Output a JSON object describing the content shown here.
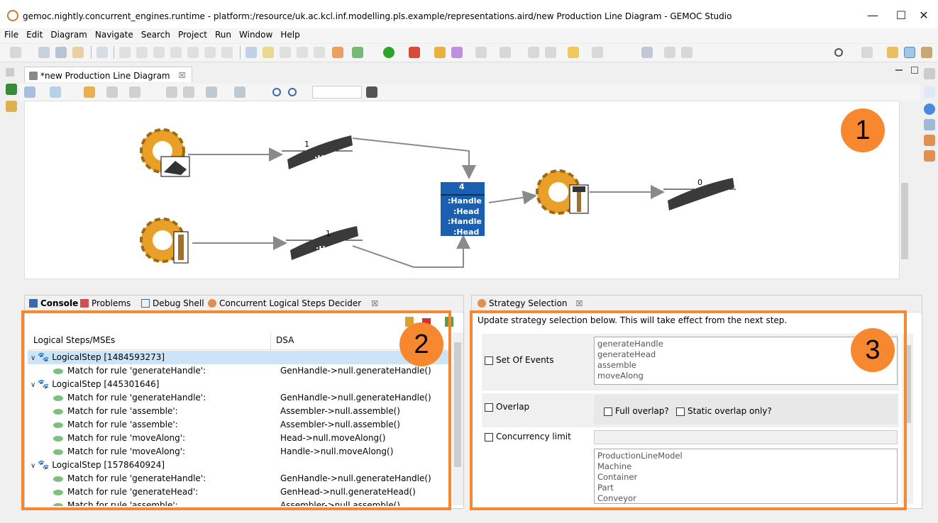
{
  "window": {
    "title": "gemoc.nightly.concurrent_engines.runtime - platform:/resource/uk.ac.kcl.inf.modelling.pls.example/representations.aird/new Production Line Diagram - GEMOC Studio",
    "minimize": "—",
    "maximize": "☐",
    "close": "✕"
  },
  "menu": [
    "File",
    "Edit",
    "Diagram",
    "Navigate",
    "Search",
    "Project",
    "Run",
    "Window",
    "Help"
  ],
  "editor": {
    "tab_label": "*new Production Line Diagram",
    "tab_close": "☒"
  },
  "diagram": {
    "nodes": {
      "head_conveyor_top": {
        "count": "1",
        "label": ":Head"
      },
      "handle_conveyor_bottom": {
        "count": "1",
        "label": ":Handle"
      },
      "container": {
        "count": "4",
        "items": [
          ":Handle",
          ":Head",
          ":Handle",
          ":Head"
        ]
      },
      "output_conveyor": {
        "count": "0"
      }
    }
  },
  "console_panel": {
    "tabs": [
      "Console",
      "Problems",
      "Debug Shell",
      "Concurrent Logical Steps Decider"
    ],
    "columns": [
      "Logical Steps/MSEs",
      "DSA"
    ],
    "rows": [
      {
        "kind": "step",
        "label": "LogicalStep [1484593273]",
        "dsa": ""
      },
      {
        "kind": "mse",
        "label": "Match for rule 'generateHandle':",
        "dsa": "GenHandle->null.generateHandle()"
      },
      {
        "kind": "step",
        "label": "LogicalStep [445301646]",
        "dsa": ""
      },
      {
        "kind": "mse",
        "label": "Match for rule 'generateHandle':",
        "dsa": "GenHandle->null.generateHandle()"
      },
      {
        "kind": "mse",
        "label": "Match for rule 'assemble':",
        "dsa": "Assembler->null.assemble()"
      },
      {
        "kind": "mse",
        "label": "Match for rule 'assemble':",
        "dsa": "Assembler->null.assemble()"
      },
      {
        "kind": "mse",
        "label": "Match for rule 'moveAlong':",
        "dsa": "Head->null.moveAlong()"
      },
      {
        "kind": "mse",
        "label": "Match for rule 'moveAlong':",
        "dsa": "Handle->null.moveAlong()"
      },
      {
        "kind": "step",
        "label": "LogicalStep [1578640924]",
        "dsa": ""
      },
      {
        "kind": "mse",
        "label": "Match for rule 'generateHandle':",
        "dsa": "GenHandle->null.generateHandle()"
      },
      {
        "kind": "mse",
        "label": "Match for rule 'generateHead':",
        "dsa": "GenHead->null.generateHead()"
      },
      {
        "kind": "mse",
        "label": "Match for rule 'assemble':",
        "dsa": "Assembler->null.assemble()"
      }
    ]
  },
  "strategy_panel": {
    "tab": "Strategy Selection",
    "instruction": "Update strategy selection below. This will take effect from the next step.",
    "set_of_events_label": "Set Of Events",
    "events": [
      "generateHandle",
      "generateHead",
      "assemble",
      "moveAlong"
    ],
    "overlap_label": "Overlap",
    "full_overlap_label": "Full overlap?",
    "static_overlap_label": "Static overlap only?",
    "concurrency_limit_label": "Concurrency limit",
    "concurrency_limit_value": "",
    "classes": [
      "ProductionLineModel",
      "Machine",
      "Container",
      "Part",
      "Conveyor"
    ]
  },
  "badges": [
    "1",
    "2",
    "3"
  ],
  "colors": {
    "highlight": "#f7882f",
    "selection": "#cce4f7",
    "container_blue": "#1a5fb0"
  }
}
